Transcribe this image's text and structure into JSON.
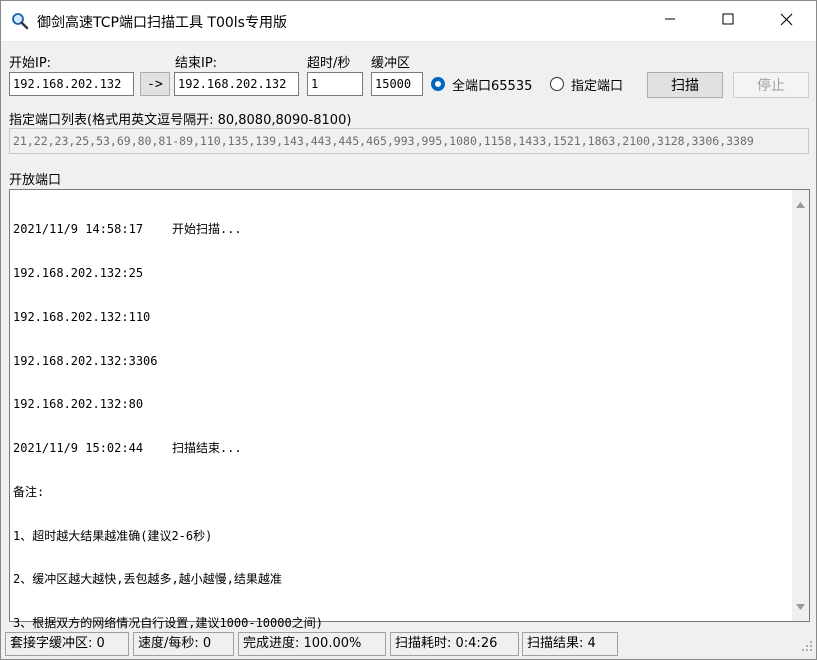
{
  "window": {
    "title": "御剑高速TCP端口扫描工具 T00ls专用版"
  },
  "form": {
    "start_ip_label": "开始IP:",
    "start_ip_value": "192.168.202.132",
    "arrow_label": "->",
    "end_ip_label": "结束IP:",
    "end_ip_value": "192.168.202.132",
    "timeout_label": "超时/秒",
    "timeout_value": "1",
    "buffer_label": "缓冲区",
    "buffer_value": "15000",
    "radio_all_label": "全端口65535",
    "radio_all_checked": true,
    "radio_specified_label": "指定端口",
    "radio_specified_checked": false,
    "scan_button": "扫描",
    "stop_button": "停止"
  },
  "portlist": {
    "label": "指定端口列表(格式用英文逗号隔开: 80,8080,8090-8100)",
    "value": "21,22,23,25,53,69,80,81-89,110,135,139,143,443,445,465,993,995,1080,1158,1433,1521,1863,2100,3128,3306,3389"
  },
  "results": {
    "label": "开放端口",
    "lines": [
      "2021/11/9 14:58:17    开始扫描...",
      "192.168.202.132:25",
      "192.168.202.132:110",
      "192.168.202.132:3306",
      "192.168.202.132:80",
      "2021/11/9 15:02:44    扫描结束...",
      "备注:",
      "1、超时越大结果越准确(建议2-6秒)",
      "2、缓冲区越大越快,丢包越多,越小越慢,结果越准",
      "3、根据双方的网络情况自行设置,建议1000-10000之间)"
    ]
  },
  "status": {
    "buffer": "套接字缓冲区: 0",
    "speed": "速度/每秒: 0",
    "progress": "完成进度: 100.00%",
    "elapsed": "扫描耗时: 0:4:26",
    "found": "扫描结果: 4"
  }
}
